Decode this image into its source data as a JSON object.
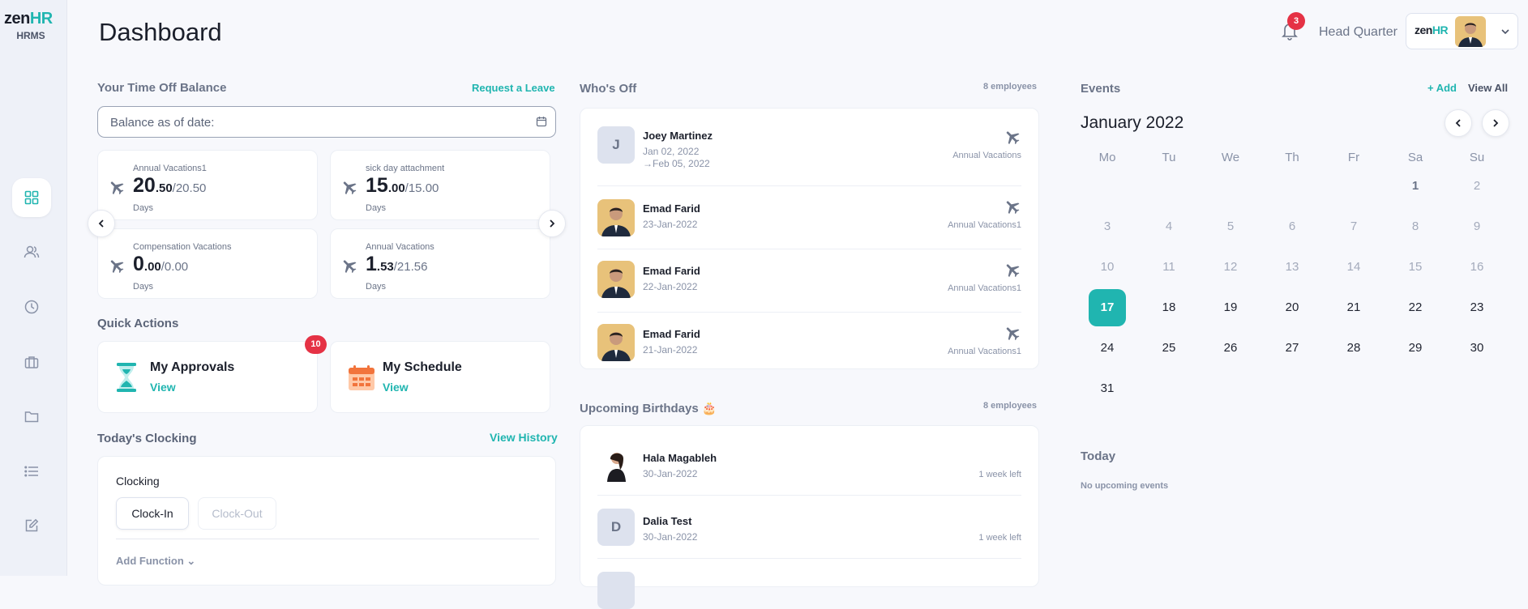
{
  "brand": {
    "logo_a": "zen",
    "logo_b": "HR",
    "sub": "HRMS"
  },
  "page": {
    "title": "Dashboard"
  },
  "header": {
    "notif_count": "3",
    "company": "Head Quarter",
    "mini_logo_a": "zen",
    "mini_logo_b": "HR"
  },
  "time_off": {
    "title": "Your Time Off Balance",
    "request": "Request a Leave",
    "date_label": "Balance as of date:",
    "cards": [
      {
        "label": "Annual Vacations1",
        "int": "20",
        "dec": ".50",
        "total": "/20.50",
        "unit": "Days"
      },
      {
        "label": "sick day attachment",
        "int": "15",
        "dec": ".00",
        "total": "/15.00",
        "unit": "Days"
      },
      {
        "label": "Compensation Vacations",
        "int": "0",
        "dec": ".00",
        "total": "/0.00",
        "unit": "Days"
      },
      {
        "label": "Annual Vacations",
        "int": "1",
        "dec": ".53",
        "total": "/21.56",
        "unit": "Days"
      }
    ]
  },
  "quick_actions": {
    "title": "Quick Actions",
    "approvals": {
      "title": "My Approvals",
      "view": "View",
      "badge": "10"
    },
    "schedule": {
      "title": "My Schedule",
      "view": "View"
    }
  },
  "clocking": {
    "title": "Today's Clocking",
    "history": "View History",
    "label": "Clocking",
    "clock_in": "Clock-In",
    "clock_out": "Clock-Out",
    "add": "Add Function"
  },
  "whos_off": {
    "title": "Who's Off",
    "count": "8 employees",
    "rows": [
      {
        "initial": "J",
        "name": "Joey Martinez",
        "date": "Jan 02, 2022",
        "date2": "Feb 05, 2022",
        "type": "Annual Vacations"
      },
      {
        "name": "Emad Farid",
        "date": "23-Jan-2022",
        "type": "Annual Vacations1"
      },
      {
        "name": "Emad Farid",
        "date": "22-Jan-2022",
        "type": "Annual Vacations1"
      },
      {
        "name": "Emad Farid",
        "date": "21-Jan-2022",
        "type": "Annual Vacations1"
      }
    ]
  },
  "birthdays": {
    "title": "Upcoming Birthdays 🎂",
    "count": "8 employees",
    "rows": [
      {
        "name": "Hala Magableh",
        "date": "30-Jan-2022",
        "left": "1 week left"
      },
      {
        "initial": "D",
        "name": "Dalia Test",
        "date": "30-Jan-2022",
        "left": "1 week left"
      }
    ]
  },
  "events": {
    "title": "Events",
    "add": "+ Add",
    "view_all": "View All",
    "month": "January 2022",
    "weekdays": [
      "Mo",
      "Tu",
      "We",
      "Th",
      "Fr",
      "Sa",
      "Su"
    ],
    "today_title": "Today",
    "no_events": "No upcoming events"
  },
  "colors": {
    "accent": "#20b5b0",
    "badge": "#e53245"
  }
}
